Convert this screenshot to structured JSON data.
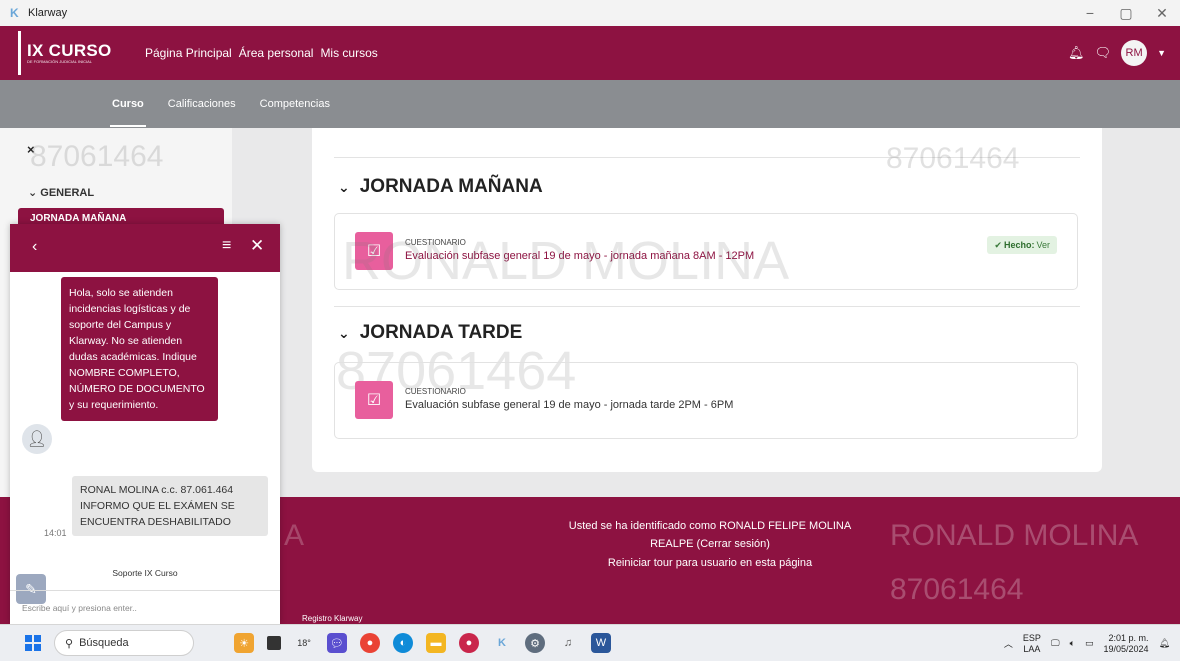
{
  "window": {
    "title": "Klarway",
    "controls": [
      "−",
      "▢",
      "✕"
    ]
  },
  "header": {
    "brand_title": "IX CURSO",
    "brand_subtitle": "DE FORMACIÓN JUDICIAL INICIAL",
    "nav": [
      "Página Principal",
      "Área personal",
      "Mis cursos"
    ],
    "user_initials": "RM"
  },
  "subnav": {
    "tabs": [
      "Curso",
      "Calificaciones",
      "Competencias"
    ],
    "active": "Curso"
  },
  "drawer": {
    "close_glyph": "×",
    "general_label": "GENERAL",
    "active_item": "JORNADA MAÑANA"
  },
  "main": {
    "sections": [
      {
        "title": "JORNADA MAÑANA",
        "activity": {
          "type": "CUESTIONARIO",
          "name": "Evaluación subfase general 19 de mayo - jornada mañana 8AM - 12PM",
          "status_label": "Hecho:",
          "status_link": "Ver"
        }
      },
      {
        "title": "JORNADA TARDE",
        "activity": {
          "type": "CUESTIONARIO",
          "name": "Evaluación subfase general 19 de mayo - jornada tarde 2PM - 6PM"
        }
      }
    ]
  },
  "watermarks": {
    "id": "87061464",
    "name": "RONALD MOLINA",
    "name_fragment": "A",
    "name_part": "RONALD MOLINA"
  },
  "footer": {
    "identified_text": "Usted se ha identificado como RONALD FELIPE MOLINA REALPE (Cerrar sesión)",
    "tour_link": "Reiniciar tour para usuario en esta página",
    "registered": "Registro Klarway"
  },
  "chat": {
    "incoming_message": "Hola, solo se atienden incidencias logísticas y de soporte del Campus y Klarway. No se atienden dudas académicas. Indique NOMBRE COMPLETO, NÚMERO DE DOCUMENTO y su requerimiento.",
    "outgoing_message": "RONAL MOLINA c.c. 87.061.464 INFORMO QUE EL EXÁMEN SE ENCUENTRA DESHABILITADO",
    "outgoing_time": "14:01",
    "brand_label": "Soporte IX Curso",
    "input_placeholder": "Escribe aquí y presiona enter.."
  },
  "taskbar": {
    "search_label": "Búsqueda",
    "weather": "18°",
    "lang_top": "ESP",
    "lang_bottom": "LAA",
    "time": "2:01 p. m.",
    "date": "19/05/2024"
  },
  "colors": {
    "brand": "#8d1241",
    "subnav": "#8a8d91",
    "quiz_icon": "#e85f9d"
  }
}
